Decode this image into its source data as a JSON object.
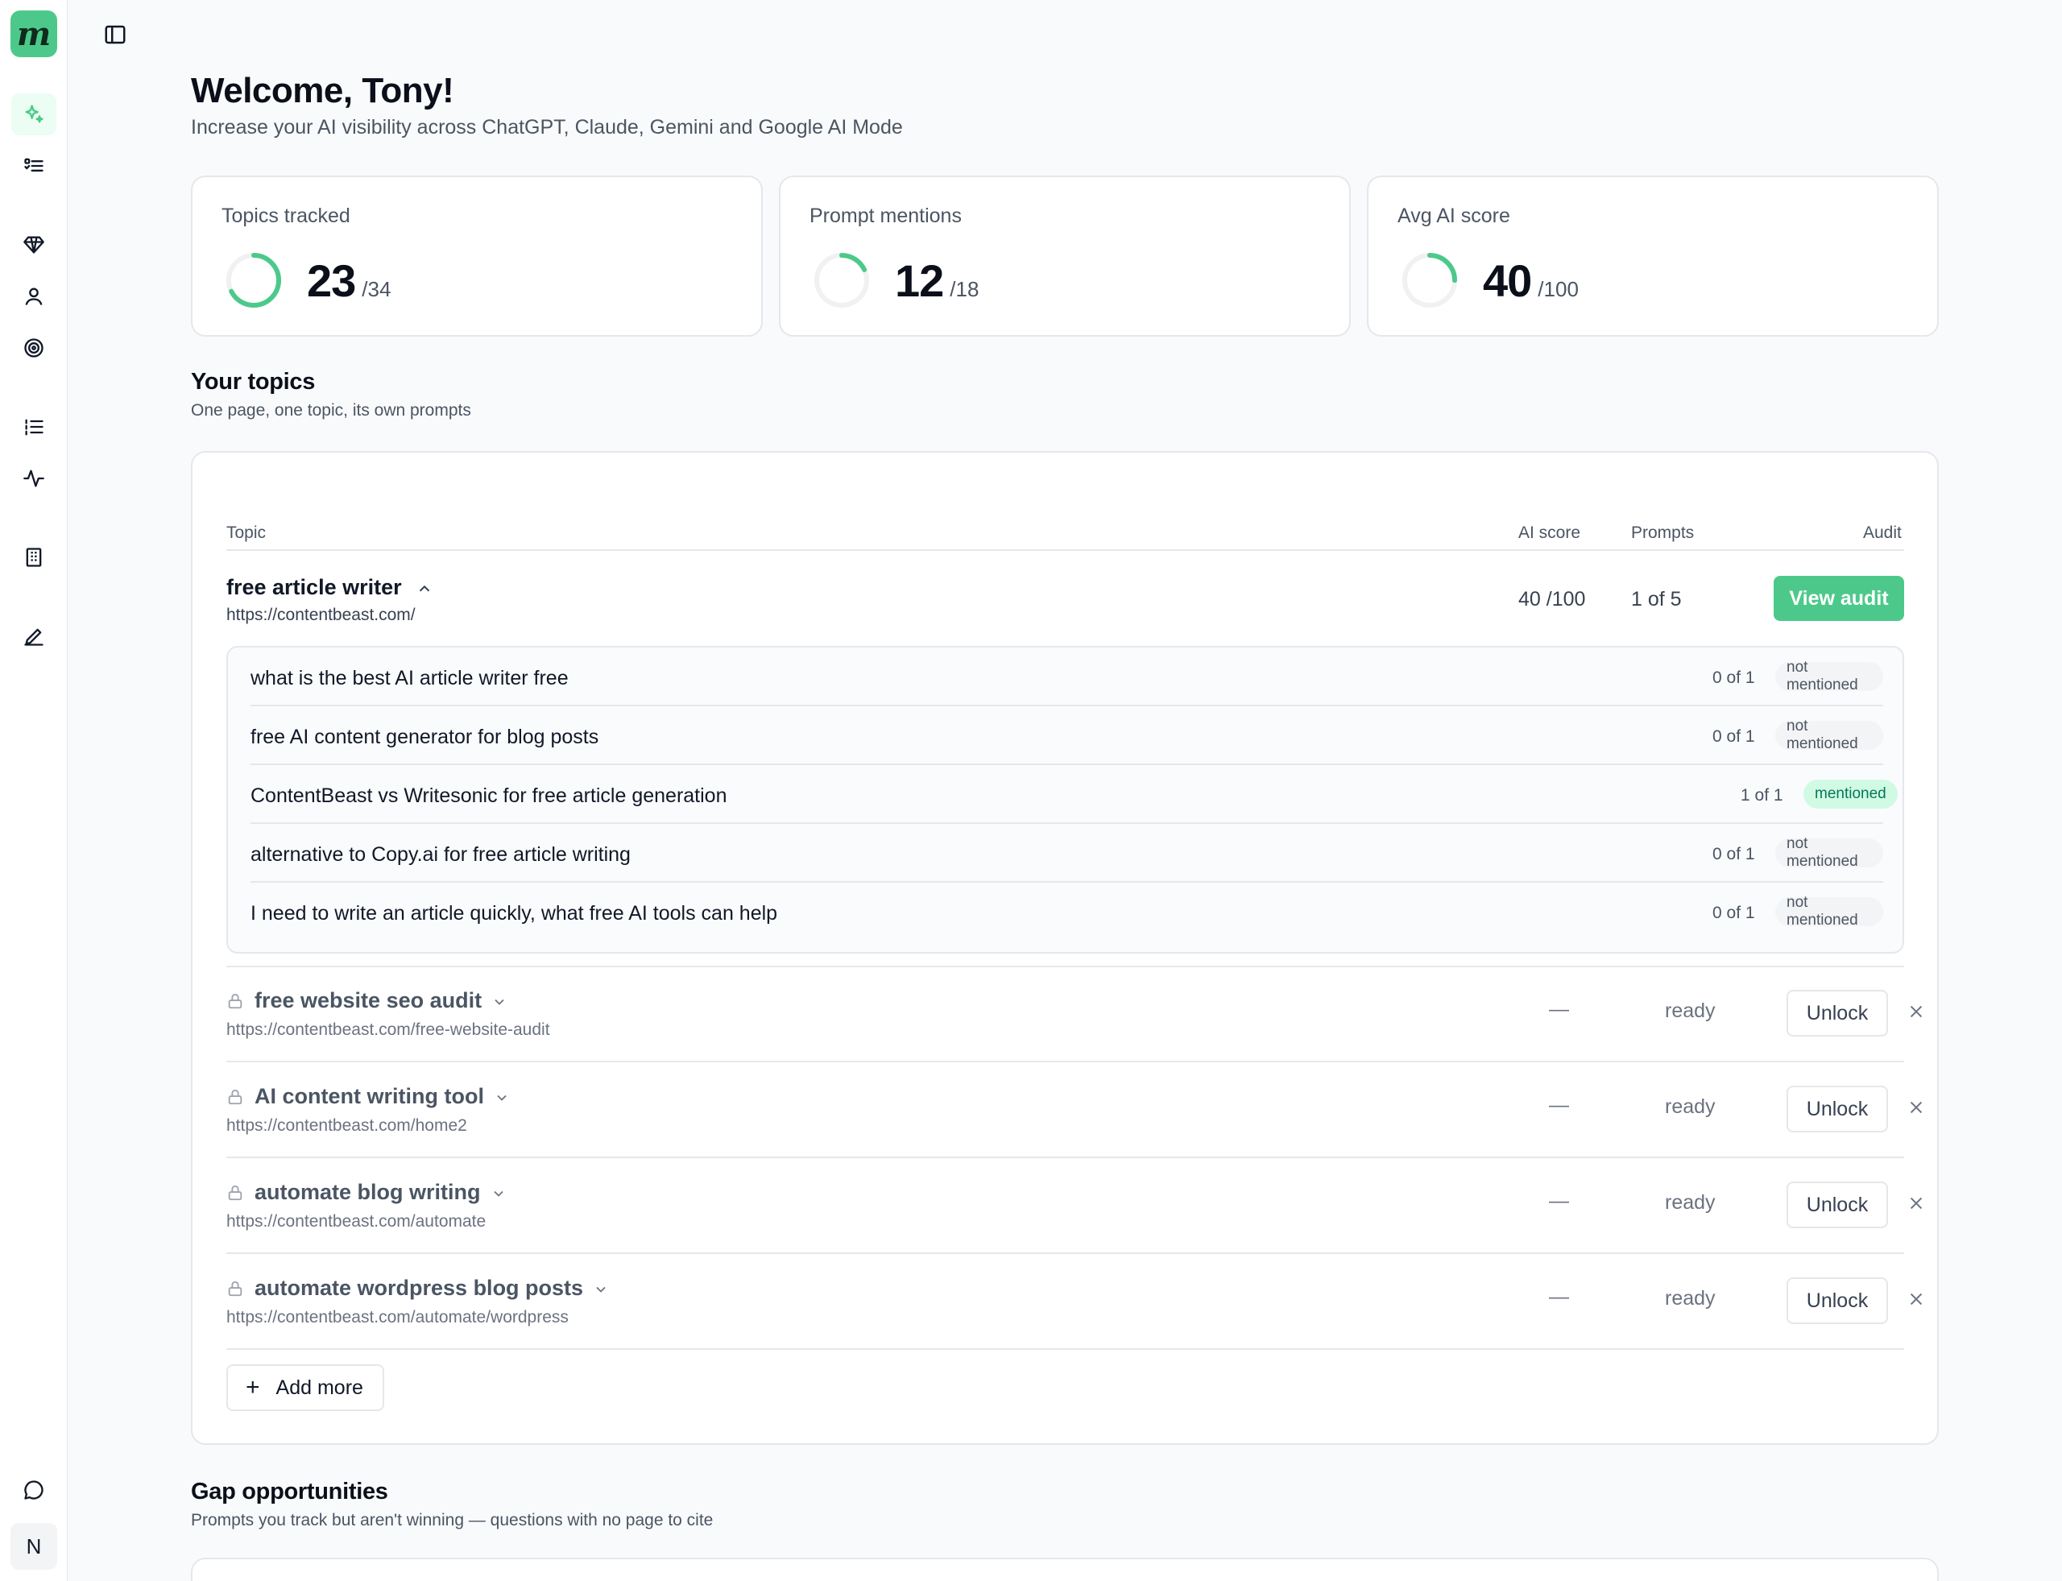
{
  "app": {
    "logo_letter": "m",
    "avatar_initial": "N"
  },
  "sidebar": {
    "items": [
      {
        "name": "sparkle-icon",
        "active": true
      },
      {
        "name": "checklist-icon"
      },
      {
        "name": "diamond-icon"
      },
      {
        "name": "user-icon"
      },
      {
        "name": "target-icon"
      },
      {
        "name": "list-ordered-icon"
      },
      {
        "name": "activity-icon"
      },
      {
        "name": "building-icon"
      },
      {
        "name": "pen-icon"
      },
      {
        "name": "chat-icon"
      }
    ]
  },
  "header": {
    "title": "Welcome, Tony!",
    "subtitle": "Increase your AI visibility across ChatGPT, Claude, Gemini and Google AI Mode"
  },
  "stats": [
    {
      "label": "Topics tracked",
      "value": "23",
      "total": "/34",
      "fraction": 0.676
    },
    {
      "label": "Prompt mentions",
      "value": "12",
      "total": "/18",
      "fraction": 0.18
    },
    {
      "label": "Avg AI score",
      "value": "40",
      "total": "/100",
      "fraction": 0.25
    }
  ],
  "topics_section": {
    "title": "Your topics",
    "subtitle": "One page, one topic, its own prompts",
    "columns": {
      "topic": "Topic",
      "score": "AI score",
      "prompts": "Prompts",
      "audit": "Audit"
    },
    "expanded": {
      "name": "free article writer",
      "url": "https://contentbeast.com/",
      "score": "40 /100",
      "prompts": "1 of 5",
      "audit_label": "View audit",
      "prompt_rows": [
        {
          "text": "what is the best AI article writer free",
          "count": "0 of 1",
          "status": "not mentioned"
        },
        {
          "text": "free AI content generator for blog posts",
          "count": "0 of 1",
          "status": "not mentioned"
        },
        {
          "text": "ContentBeast vs Writesonic for free article generation",
          "count": "1 of 1",
          "status": "mentioned"
        },
        {
          "text": "alternative to Copy.ai for free article writing",
          "count": "0 of 1",
          "status": "not mentioned"
        },
        {
          "text": "I need to write an article quickly, what free AI tools can help",
          "count": "0 of 1",
          "status": "not mentioned"
        }
      ]
    },
    "locked": [
      {
        "name": "free website seo audit",
        "url": "https://contentbeast.com/free-website-audit",
        "score": "—",
        "status": "ready",
        "action": "Unlock"
      },
      {
        "name": "AI content writing tool",
        "url": "https://contentbeast.com/home2",
        "score": "—",
        "status": "ready",
        "action": "Unlock"
      },
      {
        "name": "automate blog writing",
        "url": "https://contentbeast.com/automate",
        "score": "—",
        "status": "ready",
        "action": "Unlock"
      },
      {
        "name": "automate wordpress blog posts",
        "url": "https://contentbeast.com/automate/wordpress",
        "score": "—",
        "status": "ready",
        "action": "Unlock"
      }
    ],
    "add_more_label": "Add more"
  },
  "gap_section": {
    "title": "Gap opportunities",
    "subtitle": "Prompts you track but aren't winning — questions with no page to cite"
  },
  "colors": {
    "accent": "#4cc98a",
    "ring_track": "#f0f1f3",
    "mentioned_bg": "#d1fae5",
    "mentioned_text": "#047857"
  }
}
